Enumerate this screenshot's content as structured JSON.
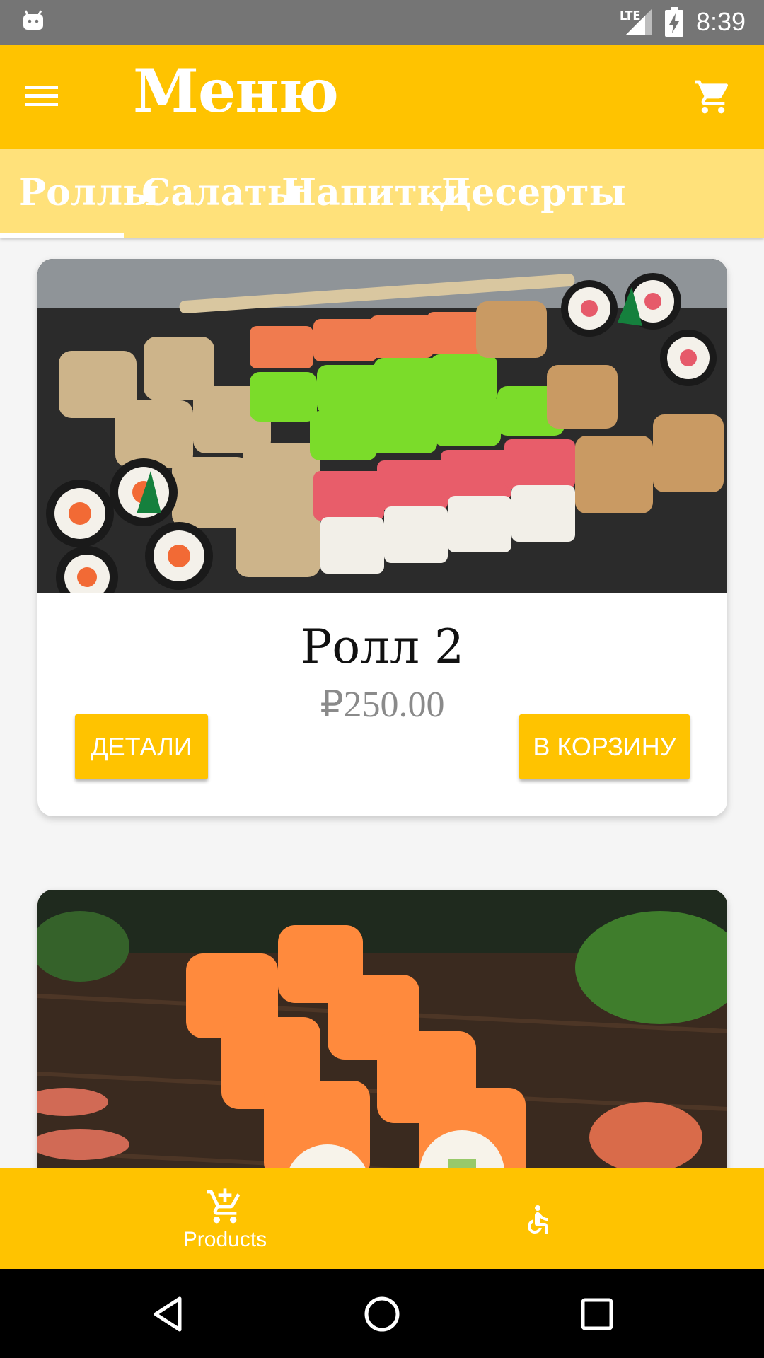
{
  "status_bar": {
    "time": "8:39",
    "network": "LTE"
  },
  "app_bar": {
    "title": "Меню",
    "menu_icon": "hamburger-menu-icon",
    "cart_icon": "cart-icon"
  },
  "tabs": [
    {
      "label": "Роллы",
      "selected": true
    },
    {
      "label": "Салаты",
      "selected": false
    },
    {
      "label": "Напитки",
      "selected": false
    },
    {
      "label": "Десерты",
      "selected": false
    }
  ],
  "products": [
    {
      "name": "Ролл 2",
      "price": "₽250.00",
      "details_label": "ДЕТАЛИ",
      "add_to_cart_label": "В КОРЗИНУ"
    }
  ],
  "bottom_nav": {
    "items": [
      {
        "label": "Products",
        "icon": "add-shopping-cart-icon"
      },
      {
        "label": "",
        "icon": "accessible-icon"
      }
    ]
  },
  "theme": {
    "primary": "#ffc300",
    "tab_bar": "#ffe17a",
    "status_bar": "#757575"
  }
}
